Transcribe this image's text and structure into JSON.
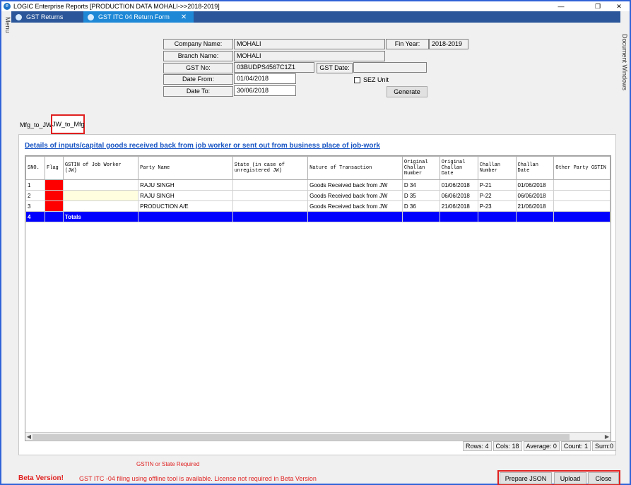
{
  "window": {
    "title": "LOGIC Enterprise Reports  [PRODUCTION DATA MOHALI->>2018-2019]",
    "minimize": "—",
    "restore": "❐",
    "close": "✕"
  },
  "doc_tabs": [
    {
      "label": "GST Returns"
    },
    {
      "label": "GST ITC 04 Return Form",
      "close": "✕"
    }
  ],
  "side": {
    "left": "Menu",
    "right": "Document Windows"
  },
  "form": {
    "company_label": "Company Name:",
    "company_value": "MOHALI",
    "fin_year_label": "Fin Year:",
    "fin_year_value": "2018-2019",
    "branch_label": "Branch Name:",
    "branch_value": "MOHALI",
    "gst_no_label": "GST No:",
    "gst_no_value": "03BUDPS4567C1Z1",
    "gst_date_label": "GST Date:",
    "gst_date_value": "",
    "date_from_label": "Date From:",
    "date_from_value": "01/04/2018",
    "date_to_label": "Date To:",
    "date_to_value": "30/06/2018",
    "sez_label": "SEZ Unit",
    "generate_label": "Generate"
  },
  "tabs": [
    {
      "label": "Mfg_to_JW"
    },
    {
      "label": "JW_to_Mfg"
    }
  ],
  "heading": "Details of inputs/capital goods received back from job worker or sent out from business place of job-work",
  "table": {
    "columns": [
      "SNO.",
      "Flag",
      "GSTIN of Job Worker\n(JW)",
      "Party Name",
      "State (in case of\nunregistered JW)",
      "Nature of Transaction",
      "Original\nChallan\nNumber",
      "Original\nChallan\nDate",
      "Challan\nNumber",
      "Challan\nDate",
      "Other Party GSTIN"
    ],
    "rows": [
      {
        "sno": "1",
        "gstin": "",
        "party": "RAJU SINGH",
        "state": "",
        "nature": "Goods Received back from JW",
        "orig_no": "D  34",
        "orig_date": "01/06/2018",
        "ch_no": "P-21",
        "ch_date": "01/06/2018",
        "other": ""
      },
      {
        "sno": "2",
        "gstin": "",
        "party": "RAJU SINGH",
        "state": "",
        "nature": "Goods Received back from JW",
        "orig_no": "D  35",
        "orig_date": "06/06/2018",
        "ch_no": "P-22",
        "ch_date": "06/06/2018",
        "other": ""
      },
      {
        "sno": "3",
        "gstin": "",
        "party": "PRODUCTION A/E",
        "state": "",
        "nature": "Goods Received back from JW",
        "orig_no": "D  36",
        "orig_date": "21/06/2018",
        "ch_no": "P-23",
        "ch_date": "21/06/2018",
        "other": ""
      }
    ],
    "totals": {
      "sno": "4",
      "label": "Totals"
    }
  },
  "status": {
    "rows": "Rows: 4",
    "cols": "Cols: 18",
    "average": "Average: 0",
    "count": "Count: 1",
    "sum": "Sum:0"
  },
  "footer": {
    "warning": "GSTIN or State Required",
    "beta": "Beta Version!",
    "info": "GST ITC -04 filing using offline tool is available. License not required in Beta Version",
    "prepare_json": "Prepare JSON",
    "upload": "Upload",
    "close": "Close"
  },
  "colors": {
    "accent": "#2b579a",
    "active_tab": "#1e88d6",
    "flag": "#ff0000",
    "totals": "#0000ff",
    "warning": "#e02020"
  }
}
